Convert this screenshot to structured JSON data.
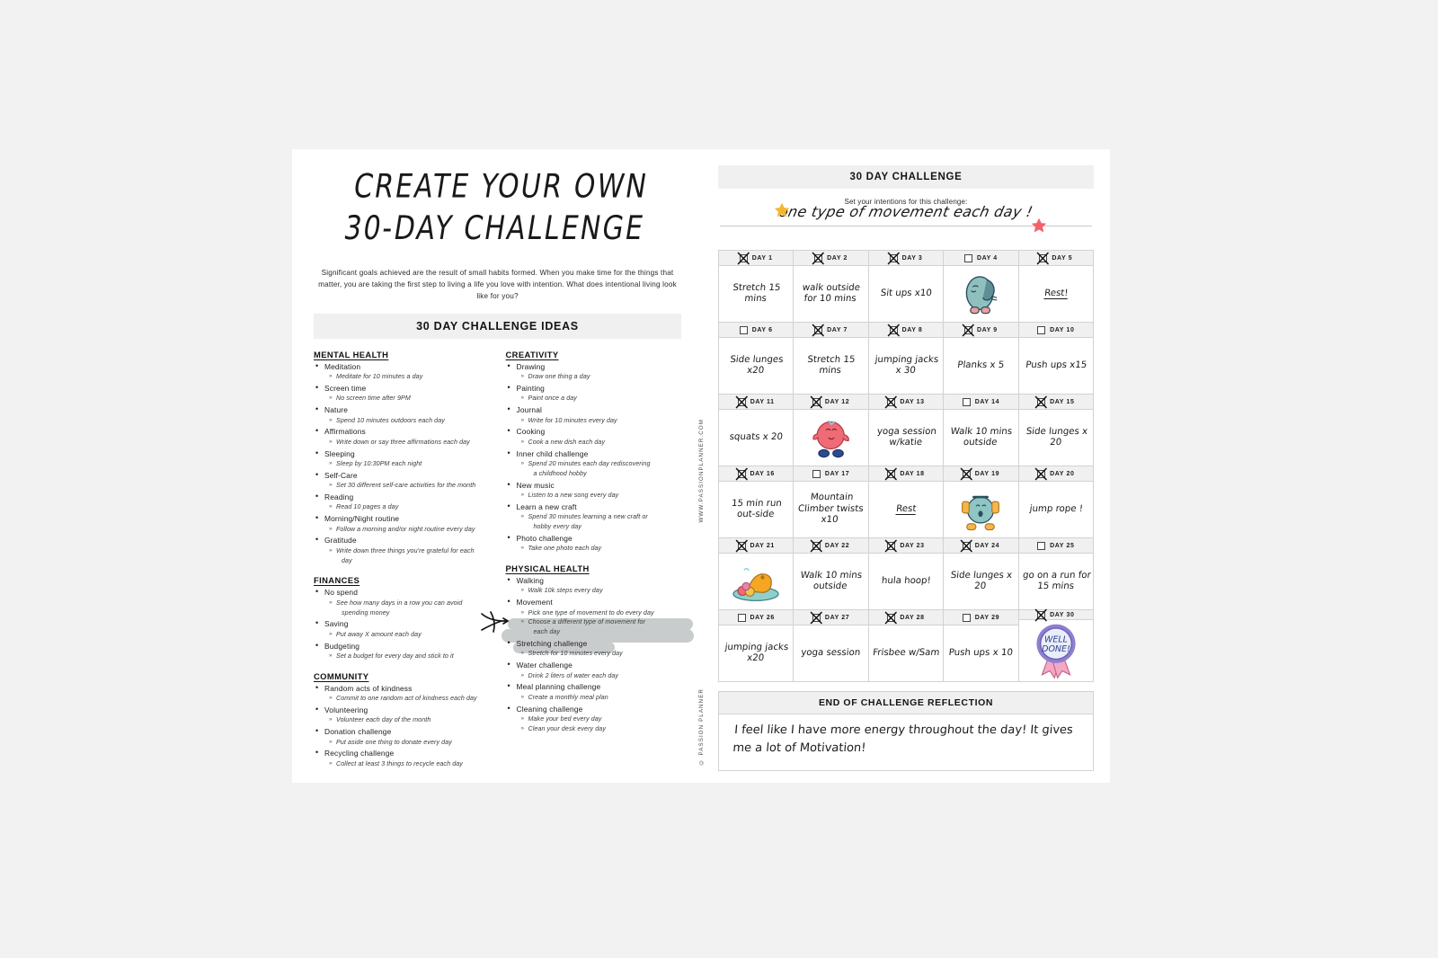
{
  "header": {
    "title_line1": "CREATE YOUR OWN",
    "title_line2": "30-DAY CHALLENGE",
    "intro": "Significant goals achieved are the result of small habits formed. When you make time for the things that matter, you are taking the first step to living a life you love with intention. What does intentional living look like for you?",
    "ideas_banner": "30 DAY CHALLENGE IDEAS"
  },
  "sidetext": {
    "url": "WWW.PASSIONPLANNER.COM",
    "copyright": "© PASSION PLANNER"
  },
  "ideas": {
    "left_column": [
      {
        "category": "MENTAL HEALTH",
        "items": [
          {
            "title": "Meditation",
            "subs": [
              "Meditate for 10 minutes a day"
            ]
          },
          {
            "title": "Screen time",
            "subs": [
              "No screen time after 9PM"
            ]
          },
          {
            "title": "Nature",
            "subs": [
              "Spend 10 minutes outdoors each day"
            ]
          },
          {
            "title": "Affirmations",
            "subs": [
              "Write down or say three affirmations each day"
            ]
          },
          {
            "title": "Sleeping",
            "subs": [
              "Sleep by 10:30PM each night"
            ]
          },
          {
            "title": "Self-Care",
            "subs": [
              "Set 30 different self-care activities for the month"
            ]
          },
          {
            "title": "Reading",
            "subs": [
              "Read 10 pages a day"
            ]
          },
          {
            "title": "Morning/Night routine",
            "subs": [
              "Follow a morning and/or night routine every day"
            ]
          },
          {
            "title": "Gratitude",
            "subs": [
              "Write down three things you're grateful for each",
              "day"
            ]
          }
        ]
      },
      {
        "category": "FINANCES",
        "items": [
          {
            "title": "No spend",
            "subs": [
              "See how many days in a row you can avoid",
              "spending money"
            ]
          },
          {
            "title": "Saving",
            "subs": [
              "Put away X amount each day"
            ]
          },
          {
            "title": "Budgeting",
            "subs": [
              "Set a budget for every day and stick to it"
            ]
          }
        ]
      },
      {
        "category": "COMMUNITY",
        "items": [
          {
            "title": "Random acts of kindness",
            "subs": [
              "Commit to one random act of kindness each day"
            ]
          },
          {
            "title": "Volunteering",
            "subs": [
              "Volunteer each day of the month"
            ]
          },
          {
            "title": "Donation challenge",
            "subs": [
              "Put aside one thing to donate every day"
            ]
          },
          {
            "title": "Recycling challenge",
            "subs": [
              "Collect at least 3 things to recycle each day"
            ]
          }
        ]
      }
    ],
    "right_column": [
      {
        "category": "CREATIVITY",
        "items": [
          {
            "title": "Drawing",
            "subs": [
              "Draw one thing a day"
            ]
          },
          {
            "title": "Painting",
            "subs": [
              "Paint once a day"
            ]
          },
          {
            "title": "Journal",
            "subs": [
              "Write for 10 minutes every day"
            ]
          },
          {
            "title": "Cooking",
            "subs": [
              "Cook a new dish each day"
            ]
          },
          {
            "title": "Inner child challenge",
            "subs": [
              "Spend 20 minutes each day rediscovering",
              "a childhood hobby"
            ]
          },
          {
            "title": "New music",
            "subs": [
              "Listen to a new song every day"
            ]
          },
          {
            "title": "Learn a new craft",
            "subs": [
              "Spend 30 minutes learning a new craft or",
              "hobby every day"
            ]
          },
          {
            "title": "Photo challenge",
            "subs": [
              "Take one photo each day"
            ]
          }
        ]
      },
      {
        "category": "PHYSICAL HEALTH",
        "items": [
          {
            "title": "Walking",
            "subs": [
              "Walk 10k steps every day"
            ]
          },
          {
            "title": "Movement",
            "subs": [
              "Pick one type of movement to do every day",
              "Choose a different type of movement for",
              "each day"
            ]
          },
          {
            "title": "Stretching challenge",
            "subs": [
              "Stretch for 10 minutes every day"
            ]
          },
          {
            "title": "Water challenge",
            "subs": [
              "Drink 2 liters of water each day"
            ]
          },
          {
            "title": "Meal planning challenge",
            "subs": [
              "Create a monthly meal plan"
            ]
          },
          {
            "title": "Cleaning challenge",
            "subs": [
              "Make your bed every day",
              "Clean your desk every day"
            ]
          }
        ]
      }
    ]
  },
  "challenge": {
    "banner": "30 DAY CHALLENGE",
    "intentions_label": "Set your intentions for this challenge:",
    "intentions_value": "one type of movement each day !",
    "day_prefix": "DAY",
    "days": [
      {
        "n": 1,
        "checked": true,
        "text": "Stretch 15 mins",
        "art": ""
      },
      {
        "n": 2,
        "checked": true,
        "text": "walk outside for 10 mins",
        "art": ""
      },
      {
        "n": 3,
        "checked": true,
        "text": "Sit ups x10",
        "art": ""
      },
      {
        "n": 4,
        "checked": false,
        "text": "",
        "art": "teal-bird-character"
      },
      {
        "n": 5,
        "checked": true,
        "text": "Rest!",
        "art": ""
      },
      {
        "n": 6,
        "checked": false,
        "text": "Side lunges x20",
        "art": ""
      },
      {
        "n": 7,
        "checked": true,
        "text": "Stretch 15 mins",
        "art": ""
      },
      {
        "n": 8,
        "checked": true,
        "text": "jumping jacks x 30",
        "art": ""
      },
      {
        "n": 9,
        "checked": true,
        "text": "Planks x 5",
        "art": ""
      },
      {
        "n": 10,
        "checked": false,
        "text": "Push ups x15",
        "art": ""
      },
      {
        "n": 11,
        "checked": true,
        "text": "squats x 20",
        "art": ""
      },
      {
        "n": 12,
        "checked": true,
        "text": "",
        "art": "pink-round-character"
      },
      {
        "n": 13,
        "checked": true,
        "text": "yoga session w/katie",
        "art": ""
      },
      {
        "n": 14,
        "checked": false,
        "text": "Walk 10 mins outside",
        "art": ""
      },
      {
        "n": 15,
        "checked": true,
        "text": "Side lunges x 20",
        "art": ""
      },
      {
        "n": 16,
        "checked": true,
        "text": "15 min run out-side",
        "art": ""
      },
      {
        "n": 17,
        "checked": false,
        "text": "Mountain Climber twists x10",
        "art": ""
      },
      {
        "n": 18,
        "checked": true,
        "text": "Rest",
        "art": ""
      },
      {
        "n": 19,
        "checked": true,
        "text": "",
        "art": "teal-weightlifter-character"
      },
      {
        "n": 20,
        "checked": true,
        "text": "jump rope !",
        "art": ""
      },
      {
        "n": 21,
        "checked": true,
        "text": "",
        "art": "orange-yoga-character"
      },
      {
        "n": 22,
        "checked": true,
        "text": "Walk 10 mins outside",
        "art": ""
      },
      {
        "n": 23,
        "checked": true,
        "text": "hula hoop!",
        "art": ""
      },
      {
        "n": 24,
        "checked": true,
        "text": "Side lunges x 20",
        "art": ""
      },
      {
        "n": 25,
        "checked": false,
        "text": "go on a run for 15 mins",
        "art": ""
      },
      {
        "n": 26,
        "checked": false,
        "text": "jumping jacks x20",
        "art": ""
      },
      {
        "n": 27,
        "checked": true,
        "text": "yoga session",
        "art": ""
      },
      {
        "n": 28,
        "checked": true,
        "text": "Frisbee w/Sam",
        "art": ""
      },
      {
        "n": 29,
        "checked": false,
        "text": "Push ups x 10",
        "art": ""
      },
      {
        "n": 30,
        "checked": true,
        "text": "",
        "art": "well-done-ribbon"
      }
    ],
    "well_done_line1": "WELL",
    "well_done_line2": "DONE!",
    "reflection_title": "END OF CHALLENGE REFLECTION",
    "reflection_text": "I feel like I have more energy throughout the day! It gives me a lot of Motivation!"
  },
  "colors": {
    "banner_gray": "#f0f0f0",
    "page_bg": "#f2f2f2",
    "star_yellow": "#f5b731",
    "star_pink": "#f4606c",
    "character_teal": "#92c3c0",
    "character_pink": "#ef6b76",
    "character_orange": "#f5a623",
    "ribbon_purple": "#8f7fd0",
    "highlight_gray": "#c9cccd"
  }
}
